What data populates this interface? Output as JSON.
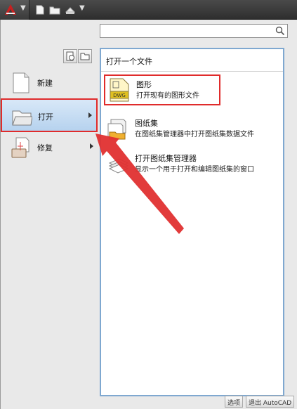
{
  "toolbar": {
    "app_button_icon": "autocad-logo-icon",
    "quick_access": [
      "new-file-icon",
      "open-folder-icon",
      "save-print-icon"
    ]
  },
  "search": {
    "placeholder": "",
    "value": ""
  },
  "view_buttons": [
    "recent-documents-icon",
    "open-documents-icon"
  ],
  "commands": [
    {
      "label": "新建",
      "icon": "new-document-icon",
      "has_submenu": false
    },
    {
      "label": "打开",
      "icon": "open-folder-icon",
      "has_submenu": true
    },
    {
      "label": "修复",
      "icon": "repair-drawing-icon",
      "has_submenu": true
    }
  ],
  "content": {
    "title": "打开一个文件",
    "items": [
      {
        "title": "图形",
        "desc": "打开现有的图形文件",
        "icon": "dwg-file-icon"
      },
      {
        "title": "图纸集",
        "desc": "在图纸集管理器中打开图纸集数据文件",
        "icon": "sheet-set-icon"
      },
      {
        "title": "打开图纸集管理器",
        "desc": "显示一个用于打开和编辑图纸集的窗口",
        "icon": "sheet-set-manager-icon"
      }
    ]
  },
  "footer": {
    "options_label": "选项",
    "exit_label": "退出 AutoCAD"
  },
  "colors": {
    "highlight_border": "#e02b2b",
    "annotation_arrow": "#e03030",
    "selected_bg": "#c4dcf2"
  }
}
